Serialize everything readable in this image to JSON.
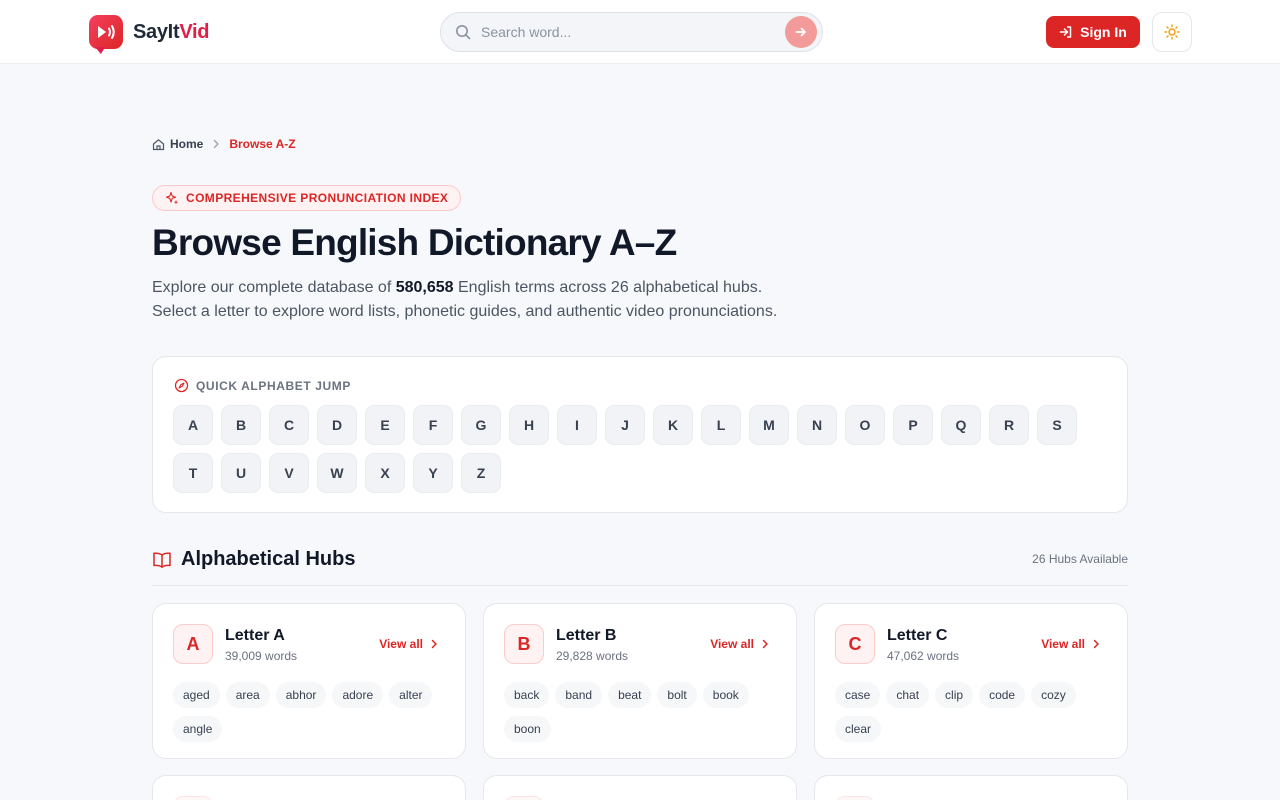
{
  "header": {
    "logo_text_main": "SayIt",
    "logo_text_accent": "Vid",
    "search_placeholder": "Search word...",
    "sign_in_label": "Sign In"
  },
  "breadcrumb": {
    "home": "Home",
    "current": "Browse A-Z"
  },
  "badge": "COMPREHENSIVE PRONUNCIATION INDEX",
  "title": "Browse English Dictionary A–Z",
  "intro": {
    "line1_before": "Explore our complete database of ",
    "count": "580,658",
    "line1_after": " English terms across 26 alphabetical hubs.",
    "line2": "Select a letter to explore word lists, phonetic guides, and authentic video pronunciations."
  },
  "jump": {
    "label": "QUICK ALPHABET JUMP",
    "letters": [
      "A",
      "B",
      "C",
      "D",
      "E",
      "F",
      "G",
      "H",
      "I",
      "J",
      "K",
      "L",
      "M",
      "N",
      "O",
      "P",
      "Q",
      "R",
      "S",
      "T",
      "U",
      "V",
      "W",
      "X",
      "Y",
      "Z"
    ]
  },
  "hubs": {
    "title": "Alphabetical Hubs",
    "count_label": "26 Hubs Available",
    "view_all_label": "View all",
    "cards": [
      {
        "letter": "A",
        "name": "Letter A",
        "count": "39,009 words",
        "words": [
          "aged",
          "area",
          "abhor",
          "adore",
          "alter",
          "angle"
        ]
      },
      {
        "letter": "B",
        "name": "Letter B",
        "count": "29,828 words",
        "words": [
          "back",
          "band",
          "beat",
          "bolt",
          "book",
          "boon"
        ]
      },
      {
        "letter": "C",
        "name": "Letter C",
        "count": "47,062 words",
        "words": [
          "case",
          "chat",
          "clip",
          "code",
          "cozy",
          "clear"
        ]
      }
    ]
  },
  "colors": {
    "accent": "#dc2626",
    "accent_soft": "#fef2f2",
    "background": "#f7f8fb"
  }
}
